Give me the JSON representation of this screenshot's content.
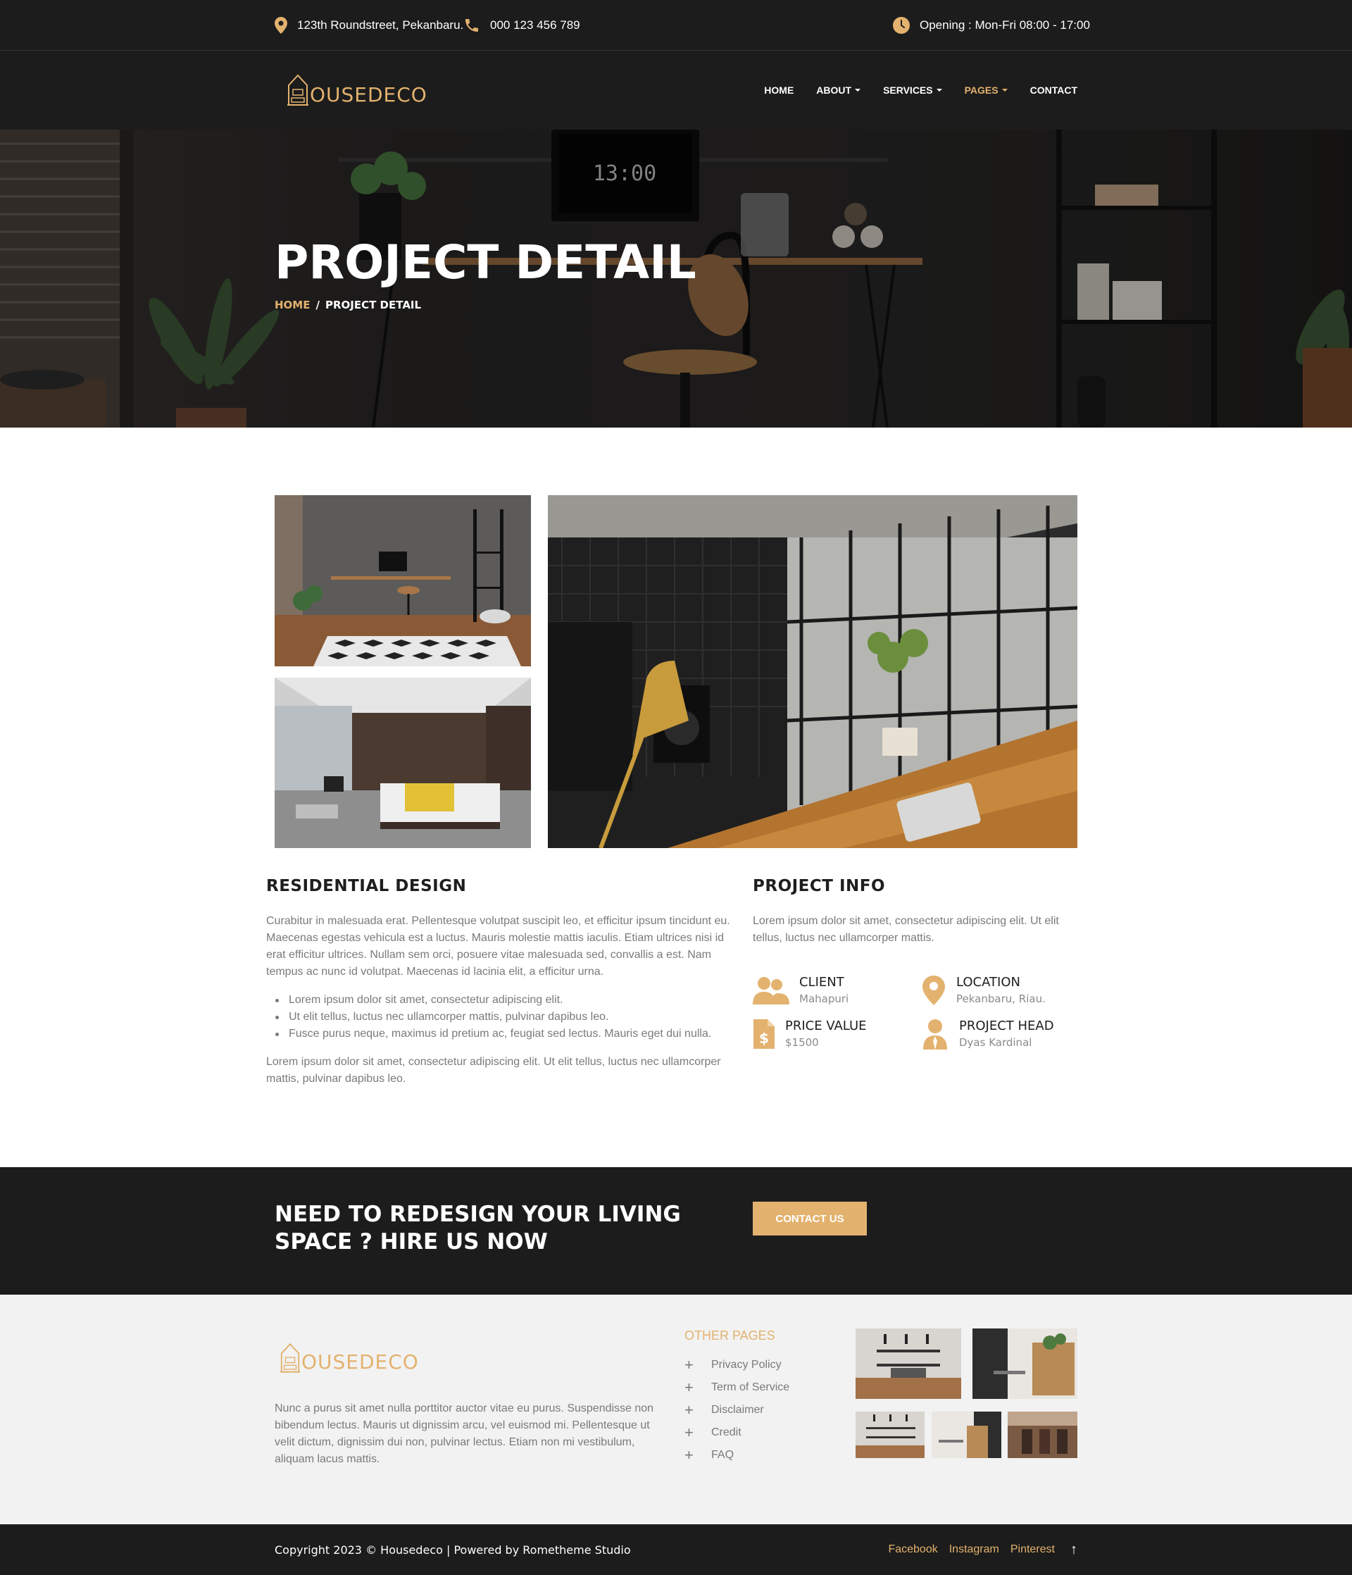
{
  "topbar": {
    "address": "123th Roundstreet, Pekanbaru.",
    "phone": "000 123 456 789",
    "opening": "Opening : Mon-Fri 08:00 - 17:00"
  },
  "header": {
    "logo_text": "OUSEDECO",
    "nav": [
      {
        "label": "HOME",
        "dropdown": false
      },
      {
        "label": "ABOUT",
        "dropdown": true
      },
      {
        "label": "SERVICES",
        "dropdown": true
      },
      {
        "label": "PAGES",
        "dropdown": true,
        "active": true
      },
      {
        "label": "CONTACT",
        "dropdown": false
      }
    ]
  },
  "hero": {
    "clock": "13:00",
    "title": "PROJECT DETAIL",
    "breadcrumb_home": "HOME",
    "breadcrumb_sep": "/",
    "breadcrumb_current": "PROJECT DETAIL"
  },
  "content": {
    "residential_title": "RESIDENTIAL DESIGN",
    "residential_para1": "Curabitur in malesuada erat. Pellentesque volutpat suscipit leo, et efficitur ipsum tincidunt eu. Maecenas egestas vehicula est a luctus. Mauris molestie mattis iaculis. Etiam ultrices nisi id erat efficitur ultrices. Nullam sem orci, posuere vitae malesuada sed, convallis a est. Nam tempus ac nunc id volutpat. Maecenas id lacinia elit, a efficitur urna.",
    "bullets": [
      "Lorem ipsum dolor sit amet, consectetur adipiscing elit.",
      "Ut elit tellus, luctus nec ullamcorper mattis, pulvinar dapibus leo.",
      "Fusce purus neque, maximus id pretium ac, feugiat sed lectus. Mauris eget dui nulla."
    ],
    "residential_para2": "Lorem ipsum dolor sit amet, consectetur adipiscing elit. Ut elit tellus, luctus nec ullamcorper mattis, pulvinar dapibus leo.",
    "project_info_title": "PROJECT INFO",
    "project_info_para": "Lorem ipsum dolor sit amet, consectetur adipiscing elit. Ut elit tellus, luctus nec ullamcorper mattis.",
    "info": {
      "client_label": "CLIENT",
      "client_value": "Mahapuri",
      "location_label": "LOCATION",
      "location_value": "Pekanbaru, Riau.",
      "price_label": "PRICE VALUE",
      "price_value": "$1500",
      "head_label": "PROJECT HEAD",
      "head_value": "Dyas Kardinal"
    }
  },
  "cta": {
    "title": "NEED TO REDESIGN YOUR LIVING SPACE ? HIRE US NOW",
    "button": "CONTACT US"
  },
  "footer": {
    "logo_text": "OUSEDECO",
    "about": "Nunc a purus sit amet nulla porttitor auctor vitae eu purus. Suspendisse non bibendum lectus. Mauris ut dignissim arcu, vel euismod mi. Pellentesque ut velit dictum, dignissim dui non, pulvinar lectus. Etiam non mi vestibulum, aliquam lacus mattis.",
    "other_pages_title": "OTHER PAGES",
    "links": [
      "Privacy Policy",
      "Term of Service",
      "Disclaimer",
      "Credit",
      "FAQ"
    ],
    "copyright": "Copyright 2023 © Housedeco | Powered by Rometheme Studio",
    "socials": [
      "Facebook",
      "Instagram",
      "Pinterest"
    ]
  },
  "colors": {
    "accent": "#e3b26e",
    "dark": "#1c1c1c",
    "footer_bg": "#f2f2f2",
    "text_muted": "#7a7a7a"
  },
  "icons": [
    "map-pin-icon",
    "phone-icon",
    "clock-icon",
    "users-icon",
    "location-pin-icon",
    "price-tag-icon",
    "person-icon",
    "plus-icon",
    "arrow-up-icon"
  ]
}
